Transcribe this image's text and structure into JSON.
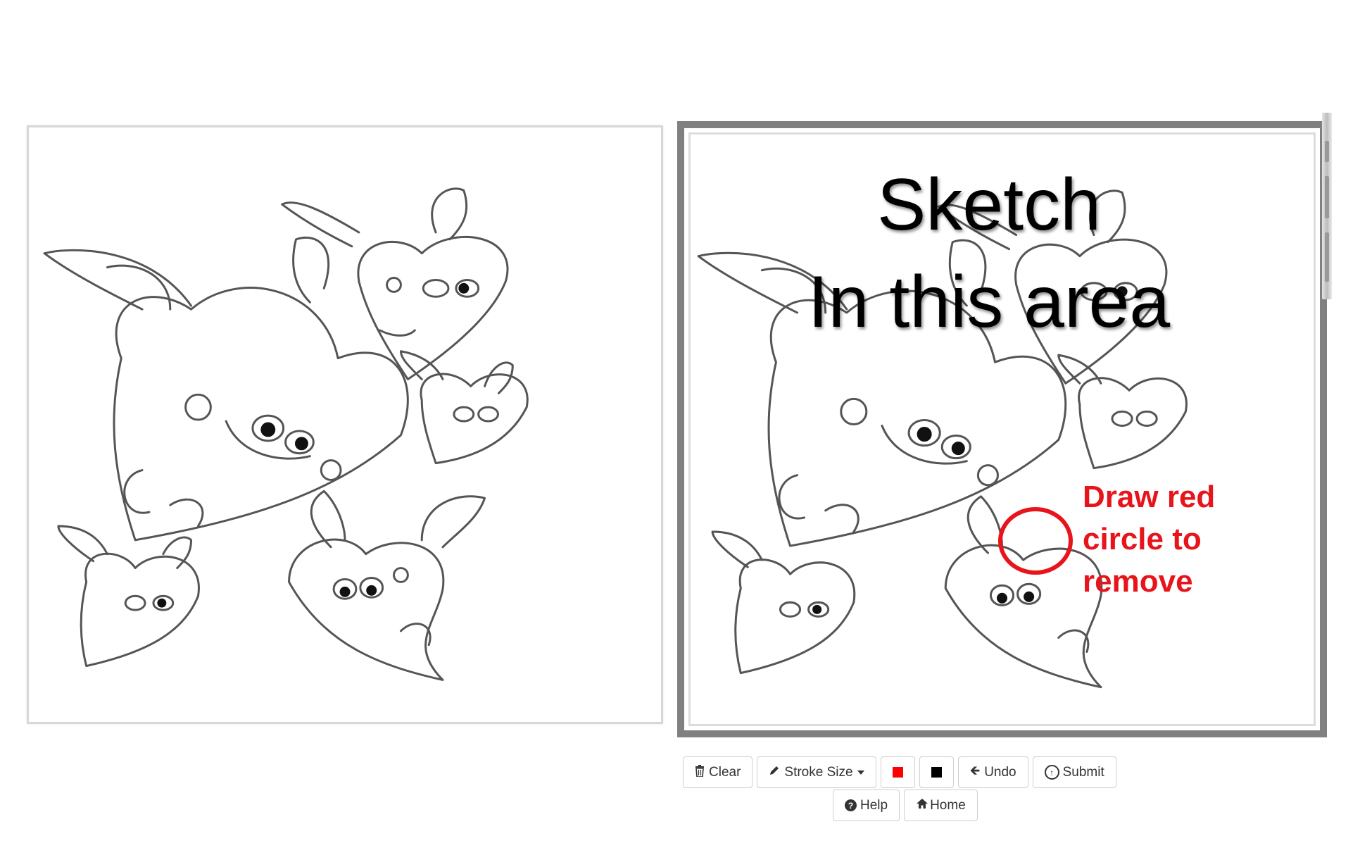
{
  "overlay": {
    "title_line1": "Sketch",
    "title_line2": "In this area"
  },
  "hint": {
    "line1": "Draw red",
    "line2": "circle to",
    "line3": "remove",
    "color": "#e8141b"
  },
  "toolbar": {
    "clear_label": "Clear",
    "stroke_size_label": "Stroke Size",
    "red_color": "#ff0000",
    "black_color": "#000000",
    "undo_label": "Undo",
    "submit_label": "Submit",
    "help_label": "Help",
    "home_label": "Home"
  },
  "icons": {
    "clear": "trash-icon",
    "stroke_size": "pencil-icon",
    "undo": "arrow-left-icon",
    "submit": "upload-circle-icon",
    "help": "question-circle-icon",
    "home": "home-icon"
  },
  "images": {
    "reference": "valentine-hearts-with-wings-coloring-page",
    "sketch_background": "valentine-hearts-with-wings-coloring-page"
  }
}
